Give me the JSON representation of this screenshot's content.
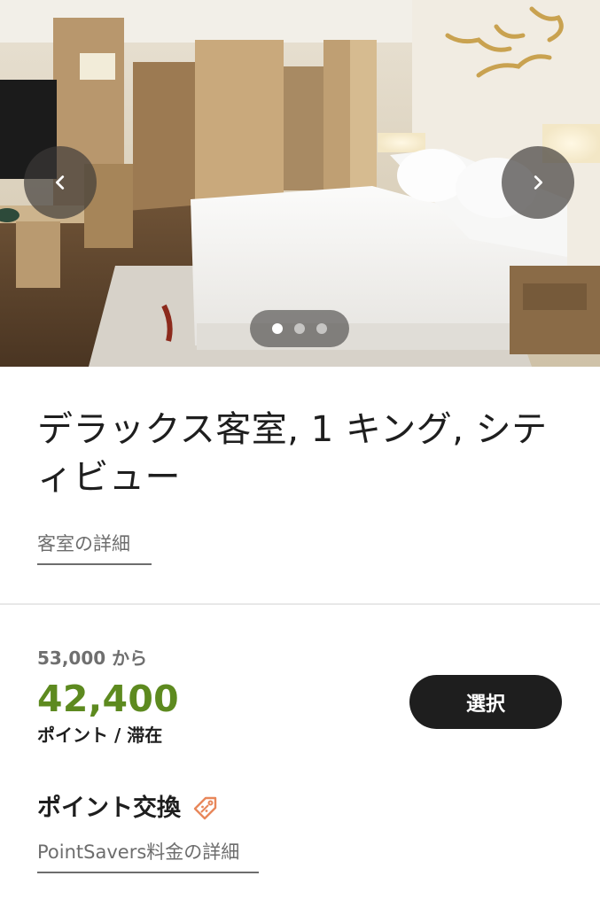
{
  "gallery": {
    "image_alt": "デラックス客室の写真",
    "current_index": 0,
    "total_images": 3,
    "prev_icon": "chevron-left-icon",
    "next_icon": "chevron-right-icon"
  },
  "room": {
    "title": "デラックス客室, 1 キング, シティビュー",
    "details_link": "客室の詳細"
  },
  "pricing": {
    "from_text": "53,000 から",
    "points": "42,400",
    "unit": "ポイント / 滞在",
    "select_label": "選択",
    "points_color": "#5d8a1f"
  },
  "redemption": {
    "heading": "ポイント交換",
    "icon": "discount-tag-icon",
    "icon_color": "#e8875a",
    "link": "PointSavers料金の詳細"
  }
}
